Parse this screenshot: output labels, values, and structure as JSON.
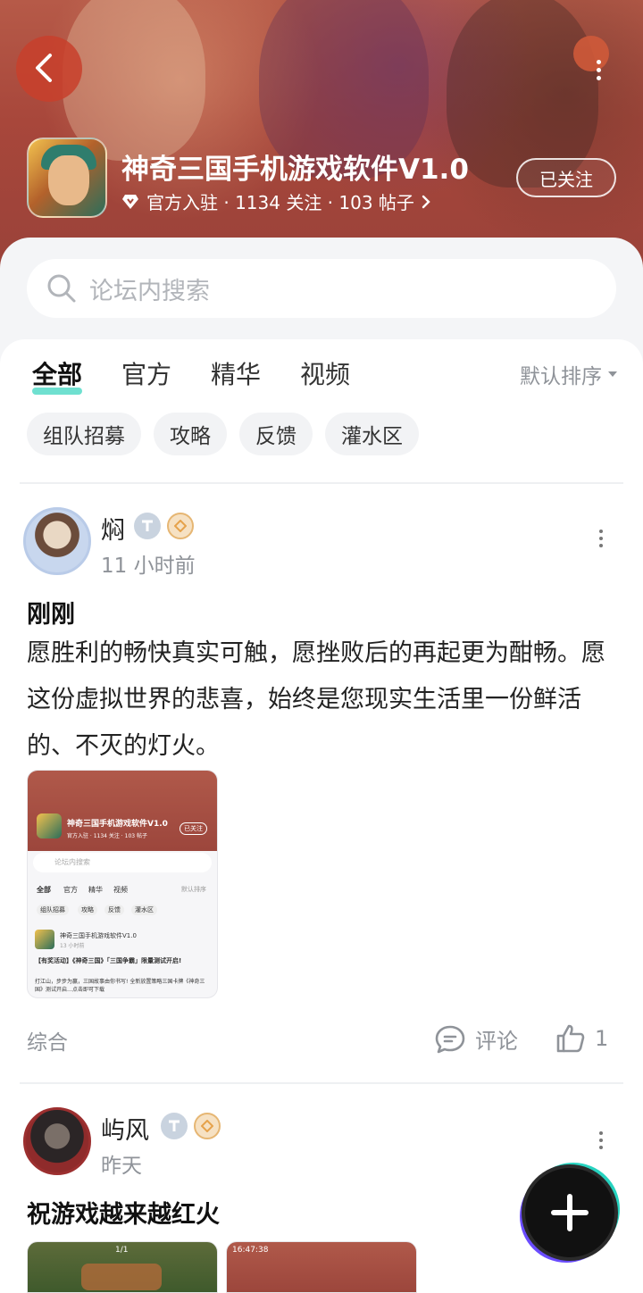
{
  "header": {
    "title": "神奇三国手机游戏软件V1.0",
    "meta": "官方入驻 · 1134 关注 · 103 帖子",
    "follow_label": "已关注",
    "icons": [
      "back-arrow-icon",
      "more-vertical-icon",
      "diamond-verified-icon",
      "chevron-right-icon"
    ]
  },
  "search": {
    "placeholder": "论坛内搜索"
  },
  "tabs": [
    {
      "label": "全部",
      "active": true
    },
    {
      "label": "官方",
      "active": false
    },
    {
      "label": "精华",
      "active": false
    },
    {
      "label": "视频",
      "active": false
    }
  ],
  "sort": {
    "label": "默认排序"
  },
  "chips": [
    "组队招募",
    "攻略",
    "反馈",
    "灌水区"
  ],
  "posts": [
    {
      "user": "焖",
      "time": "11 小时前",
      "title": "刚刚",
      "body": "愿胜利的畅快真实可触，愿挫败后的再起更为酣畅。愿这份虚拟世界的悲喜，始终是您现实生活里一份鲜活的、不灭的灯火。",
      "category": "综合",
      "comment_label": "评论",
      "like_count": "1",
      "thumbnail": {
        "title": "神奇三国手机游戏软件V1.0",
        "meta": "官方入驻 · 1134 关注 · 103 帖子",
        "follow": "已关注",
        "search": "论坛内搜索",
        "tabs": [
          "全部",
          "官方",
          "精华",
          "视频"
        ],
        "sort": "默认排序",
        "chips": [
          "组队招募",
          "攻略",
          "反馈",
          "灌水区"
        ],
        "post_user": "神奇三国手机游戏软件V1.0",
        "post_time": "13 小时前",
        "post_line1": "【有奖活动】《神奇三国》「三国争霸」限量测试开启!",
        "post_line2": "打江山，步步为赢，三国故事由你书写! 全新放置策略三国卡牌《神奇三国》测试开启…点击即可下载"
      }
    },
    {
      "user": "屿风",
      "time": "昨天",
      "title": "祝游戏越来越红火",
      "thumb_labels": [
        "1/1",
        "16:47:38"
      ]
    }
  ],
  "fab": {
    "icon": "plus-icon"
  },
  "colors": {
    "accent": "#3fd6c0",
    "banner": "#a8473b",
    "muted": "#8f9399"
  }
}
